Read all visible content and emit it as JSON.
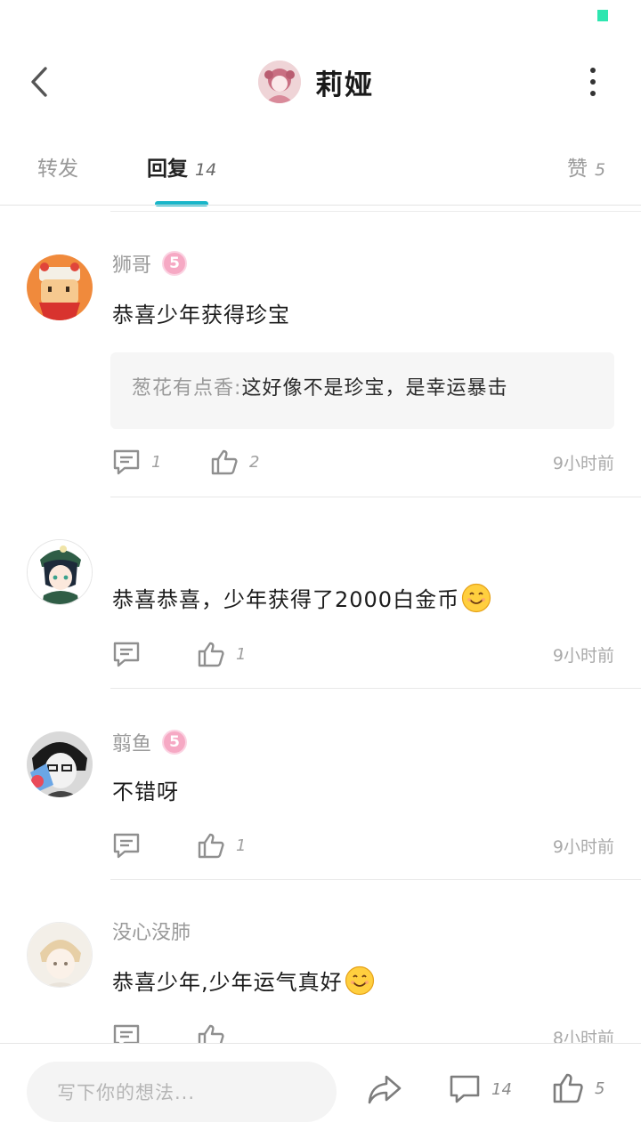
{
  "header": {
    "title": "莉娅",
    "back_icon": "chevron-left-icon",
    "more_icon": "more-vertical-icon"
  },
  "tabs": {
    "forward": {
      "label": "转发",
      "count": ""
    },
    "reply": {
      "label": "回复",
      "count": "14"
    },
    "like": {
      "label": "赞",
      "count": "5"
    }
  },
  "comments": [
    {
      "name": "狮哥",
      "level": "5",
      "text": "恭喜少年获得珍宝",
      "quote": {
        "name": "葱花有点香",
        "text": "这好像不是珍宝，是幸运暴击"
      },
      "comment_count": "1",
      "like_count": "2",
      "time": "9小时前"
    },
    {
      "name": "",
      "level": "",
      "text": "恭喜恭喜，少年获得了2000白金币",
      "comment_count": "",
      "like_count": "1",
      "time": "9小时前"
    },
    {
      "name": "翦鱼",
      "level": "5",
      "text": "不错呀",
      "comment_count": "",
      "like_count": "1",
      "time": "9小时前"
    },
    {
      "name": "没心没肺",
      "level": "",
      "text": "恭喜少年,少年运气真好",
      "comment_count": "",
      "like_count": "",
      "time": "8小时前"
    }
  ],
  "bottom_bar": {
    "placeholder": "写下你的想法...",
    "comment_count": "14",
    "like_count": "5"
  },
  "colors": {
    "accent": "#19b6c9",
    "status_indicator": "#2ee6b0",
    "level_badge": "#f6a9c4"
  }
}
